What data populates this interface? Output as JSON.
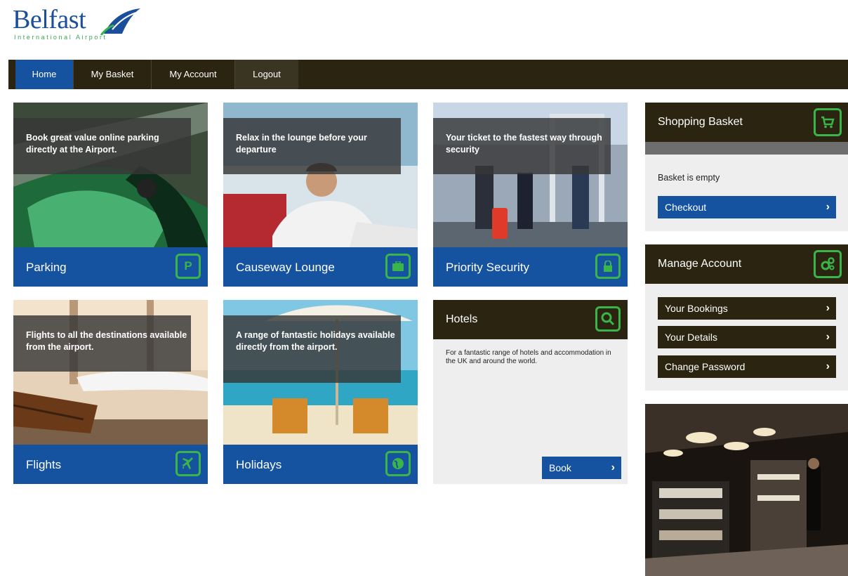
{
  "brand": {
    "name": "Belfast",
    "subtitle": "International Airport"
  },
  "nav": {
    "items": [
      "Home",
      "My Basket",
      "My Account",
      "Logout"
    ],
    "active": "Home"
  },
  "tiles": {
    "parking": {
      "caption": "Book great value online parking directly at the Airport.",
      "label": "Parking",
      "icon": "P"
    },
    "lounge": {
      "caption": "Relax in the lounge before your departure",
      "label": "Causeway Lounge"
    },
    "security": {
      "caption": "Your ticket to the fastest way through security",
      "label": "Priority Security"
    },
    "flights": {
      "caption": "Flights to all the destinations available from the airport.",
      "label": "Flights"
    },
    "holidays": {
      "caption": "A range of fantastic holidays available directly from the airport.",
      "label": "Holidays"
    }
  },
  "hotels": {
    "label": "Hotels",
    "description": "For a fantastic range of hotels and accommodation in the UK and around the world.",
    "book_label": "Book"
  },
  "basket": {
    "title": "Shopping Basket",
    "status": "Basket is empty",
    "checkout_label": "Checkout"
  },
  "account": {
    "title": "Manage Account",
    "links": [
      "Your Bookings",
      "Your Details",
      "Change Password"
    ]
  },
  "colors": {
    "accent_blue": "#1553a0",
    "dark_bar": "#2a2410",
    "icon_green": "#3ab54a"
  }
}
